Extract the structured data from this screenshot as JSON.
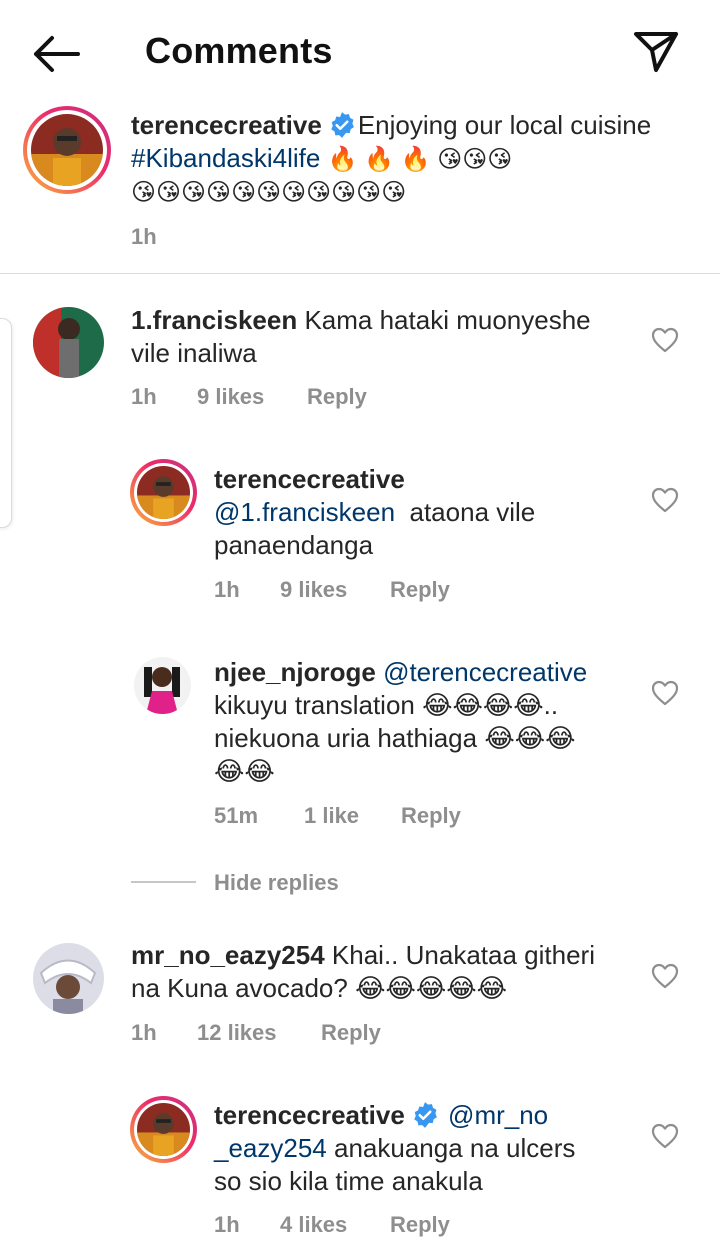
{
  "header": {
    "title": "Comments",
    "back_icon": "arrow-left-icon",
    "share_icon": "paper-plane-icon"
  },
  "caption": {
    "username": "terencecreative",
    "verified": true,
    "text": "Enjoying our local cuisine",
    "hashtag": "#Kibandaski4life",
    "emojis_line1": "🔥 🔥 🔥 😘😘😘",
    "emojis_line2": "😘😘😘😘😘😘😘😘😘😘😘",
    "time": "1h"
  },
  "comments": [
    {
      "username": "1.franciskeen",
      "text_line1": "Kama hataki muonyeshe",
      "text_line2": "vile inaliwa",
      "time": "1h",
      "likes": "9 likes",
      "reply": "Reply"
    },
    {
      "username": "terencecreative",
      "mention": "@1.franciskeen",
      "text_line1": "ataona vile",
      "text_line2": "panaendanga",
      "time": "1h",
      "likes": "9 likes",
      "reply": "Reply"
    },
    {
      "username": "njee_njoroge",
      "mention": "@terencecreative",
      "text_line2": "kikuyu translation 😂😂😂😂..",
      "text_line3": "niekuona  uria hathiaga 😂😂😂",
      "text_line4": "😂😂",
      "time": "51m",
      "likes": "1 like",
      "reply": "Reply"
    },
    {
      "username": "mr_no_eazy254",
      "text_line1": "Khai.. Unakataa githeri",
      "text_line2": "na Kuna avocado? 😂😂😂😂😂",
      "time": "1h",
      "likes": "12 likes",
      "reply": "Reply"
    },
    {
      "username": "terencecreative",
      "verified": true,
      "mention_line1": "@mr_no",
      "mention_line2": "_eazy254",
      "text_line2": "anakuanga na ulcers",
      "text_line3": "so sio kila time anakula",
      "time": "1h",
      "likes": "4 likes",
      "reply": "Reply"
    }
  ],
  "hide_replies": "Hide replies",
  "colors": {
    "link": "#00376b",
    "secondary_text": "#8e8e8e",
    "verified_badge": "#3897f0"
  }
}
